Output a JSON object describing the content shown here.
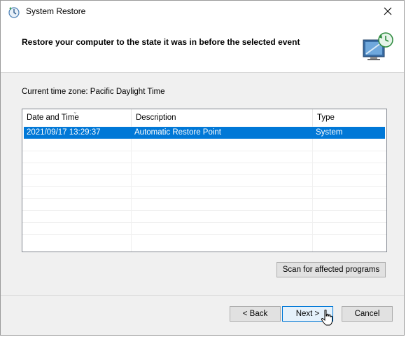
{
  "window": {
    "title": "System Restore",
    "header_title": "Restore your computer to the state it was in before the selected event"
  },
  "timezone_label": "Current time zone: Pacific Daylight Time",
  "table": {
    "columns": [
      "Date and Time",
      "Description",
      "Type"
    ],
    "rows": [
      {
        "date_time": "2021/09/17 13:29:37",
        "description": "Automatic Restore Point",
        "type": "System",
        "selected": true
      }
    ]
  },
  "buttons": {
    "scan": "Scan for affected programs",
    "back": "< Back",
    "next": "Next >",
    "cancel": "Cancel"
  },
  "colors": {
    "selection": "#0078d7",
    "default_button_border": "#0078d7"
  },
  "icons": [
    "system-restore-icon",
    "close-icon",
    "restore-monitor-icon",
    "sort-arrow-icon",
    "mouse-cursor-icon"
  ]
}
